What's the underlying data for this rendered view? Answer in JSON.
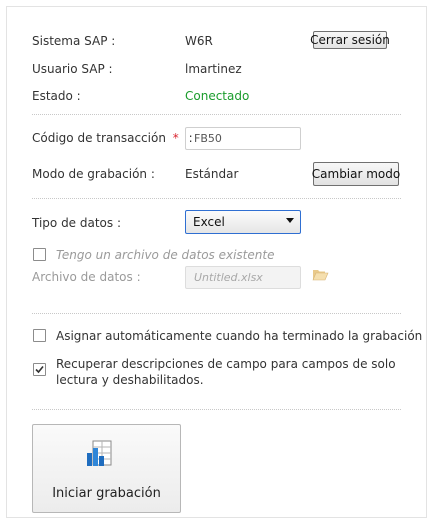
{
  "connection": {
    "system_label": "Sistema SAP :",
    "system_value": "W6R",
    "logout_button": "Cerrar sesión",
    "user_label": "Usuario SAP :",
    "user_value": "lmartinez",
    "status_label": "Estado :",
    "status_value": "Conectado",
    "status_color": "#1a9c2c"
  },
  "transaction": {
    "code_label": "Código de transacción",
    "required_mark": "*",
    "code_colon": ":",
    "code_value": "FB50",
    "mode_label": "Modo de grabación :",
    "mode_value": "Estándar",
    "change_mode_button": "Cambiar modo"
  },
  "data_source": {
    "type_label": "Tipo de datos :",
    "type_selected": "Excel",
    "existing_file_label": "Tengo un archivo de datos existente",
    "existing_file_checked": false,
    "file_label": "Archivo de datos :",
    "file_placeholder": "Untitled.xlsx",
    "folder_icon": "folder-icon"
  },
  "options": {
    "auto_assign_label": "Asignar automáticamente cuando ha terminado la grabación",
    "auto_assign_checked": false,
    "retrieve_desc_label": "Recuperar descripciones de campo para campos de solo lectura y deshabilitados.",
    "retrieve_desc_checked": true
  },
  "actions": {
    "start_recording_button": "Iniciar grabación",
    "start_recording_icon": "spreadsheet-chart-icon"
  },
  "colors": {
    "accent": "#2f6fd2",
    "required": "#d9232e"
  }
}
